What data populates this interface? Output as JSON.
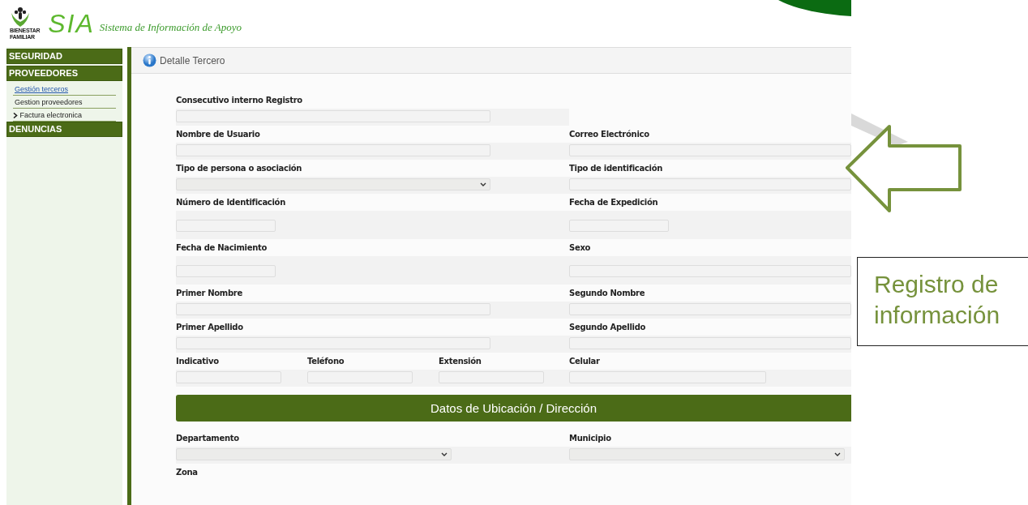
{
  "header": {
    "logo_caption": [
      "BIENESTAR",
      "FAMILIAR"
    ],
    "brand": "SIA",
    "subtitle": "Sistema de Información de Apoyo"
  },
  "sidebar": {
    "items": [
      {
        "kind": "section",
        "label": "SEGURIDAD",
        "selected": false
      },
      {
        "kind": "section",
        "label": "PROVEEDORES",
        "selected": false
      },
      {
        "kind": "link",
        "label": "Gestión terceros",
        "selected": true
      },
      {
        "kind": "link",
        "label": "Gestion proveedores",
        "selected": false
      },
      {
        "kind": "submenu",
        "label": "Factura electronica",
        "selected": false
      },
      {
        "kind": "section",
        "label": "DENUNCIAS",
        "selected": false
      }
    ]
  },
  "page": {
    "title": "Detalle Tercero"
  },
  "form": {
    "rows": [
      {
        "kind": "fields",
        "fields": [
          {
            "label": "Consecutivo interno Registro",
            "kind": "text"
          }
        ]
      },
      {
        "kind": "fields",
        "fields": [
          {
            "label": "Nombre de Usuario",
            "kind": "text"
          },
          {
            "label": "Correo Electrónico",
            "kind": "text"
          }
        ]
      },
      {
        "kind": "fields",
        "fields": [
          {
            "label": "Tipo de persona o asociación",
            "kind": "select"
          },
          {
            "label": "Tipo de identificación",
            "kind": "text"
          }
        ]
      },
      {
        "kind": "fields",
        "fields": [
          {
            "label": "Número de Identificación",
            "kind": "date"
          },
          {
            "label": "Fecha de Expedición",
            "kind": "date"
          }
        ]
      },
      {
        "kind": "fields",
        "fields": [
          {
            "label": "Fecha de Nacimiento",
            "kind": "date"
          },
          {
            "label": "Sexo",
            "kind": "text"
          }
        ]
      },
      {
        "kind": "fields",
        "fields": [
          {
            "label": "Primer Nombre",
            "kind": "text"
          },
          {
            "label": "Segundo Nombre",
            "kind": "text"
          }
        ]
      },
      {
        "kind": "fields",
        "fields": [
          {
            "label": "Primer Apellido",
            "kind": "text"
          },
          {
            "label": "Segundo Apellido",
            "kind": "text"
          }
        ]
      },
      {
        "kind": "fields",
        "fields": [
          {
            "label": "Indicativo",
            "kind": "text"
          },
          {
            "label": "Teléfono",
            "kind": "text"
          },
          {
            "label": "Extensión",
            "kind": "text"
          },
          {
            "label": "Celular",
            "kind": "text"
          }
        ]
      },
      {
        "kind": "banner",
        "title": "Datos de Ubicación / Dirección"
      },
      {
        "kind": "fields",
        "fields": [
          {
            "label": "Departamento",
            "kind": "select"
          },
          {
            "label": "Municipio",
            "kind": "select"
          }
        ]
      },
      {
        "kind": "fields",
        "fields": [
          {
            "label": "Zona",
            "kind": "label"
          }
        ]
      }
    ]
  },
  "callout": {
    "text": "Registro de información"
  }
}
